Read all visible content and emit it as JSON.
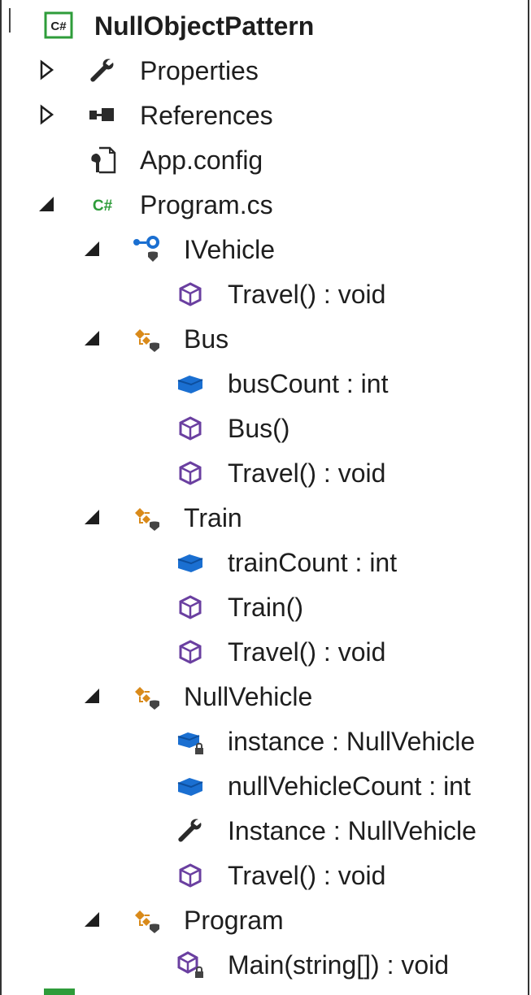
{
  "tree": {
    "project": {
      "label": "NullObjectPattern",
      "icon": "csharp-project-icon"
    },
    "items": [
      {
        "label": "Properties",
        "icon": "wrench-icon",
        "expander": "collapsed"
      },
      {
        "label": "References",
        "icon": "references-icon",
        "expander": "collapsed"
      },
      {
        "label": "App.config",
        "icon": "config-file-icon",
        "expander": "none"
      },
      {
        "label": "Program.cs",
        "icon": "csharp-file-icon",
        "expander": "expanded"
      },
      {
        "label": "IVehicle",
        "icon": "interface-icon",
        "expander": "expanded"
      },
      {
        "label": "Travel() : void",
        "icon": "method-icon",
        "expander": "none"
      },
      {
        "label": "Bus",
        "icon": "class-icon",
        "expander": "expanded"
      },
      {
        "label": "busCount : int",
        "icon": "field-icon",
        "expander": "none"
      },
      {
        "label": "Bus()",
        "icon": "method-icon",
        "expander": "none"
      },
      {
        "label": "Travel() : void",
        "icon": "method-icon",
        "expander": "none"
      },
      {
        "label": "Train",
        "icon": "class-icon",
        "expander": "expanded"
      },
      {
        "label": "trainCount : int",
        "icon": "field-icon",
        "expander": "none"
      },
      {
        "label": "Train()",
        "icon": "method-icon",
        "expander": "none"
      },
      {
        "label": "Travel() : void",
        "icon": "method-icon",
        "expander": "none"
      },
      {
        "label": "NullVehicle",
        "icon": "class-icon",
        "expander": "expanded"
      },
      {
        "label": "instance : NullVehicle",
        "icon": "private-field-icon",
        "expander": "none"
      },
      {
        "label": "nullVehicleCount : int",
        "icon": "field-icon",
        "expander": "none"
      },
      {
        "label": "Instance : NullVehicle",
        "icon": "property-wrench-icon",
        "expander": "none"
      },
      {
        "label": "Travel() : void",
        "icon": "method-icon",
        "expander": "none"
      },
      {
        "label": "Program",
        "icon": "class-icon",
        "expander": "expanded"
      },
      {
        "label": "Main(string[]) : void",
        "icon": "private-method-icon",
        "expander": "none"
      }
    ]
  },
  "colors": {
    "csharp_green": "#2e9c3a",
    "method_purple": "#6a3fa0",
    "field_blue": "#1a6fd1",
    "class_orange": "#d98a1a",
    "text": "#1e1e1e"
  }
}
